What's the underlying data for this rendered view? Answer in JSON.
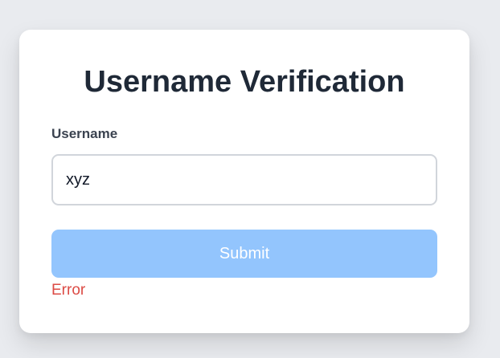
{
  "form": {
    "title": "Username Verification",
    "username_label": "Username",
    "username_value": "xyz",
    "submit_label": "Submit",
    "error_text": "Error"
  },
  "colors": {
    "background": "#e9ebef",
    "card": "#ffffff",
    "title_text": "#1f2937",
    "submit_disabled": "#93c5fd",
    "error": "#dc4b45"
  }
}
